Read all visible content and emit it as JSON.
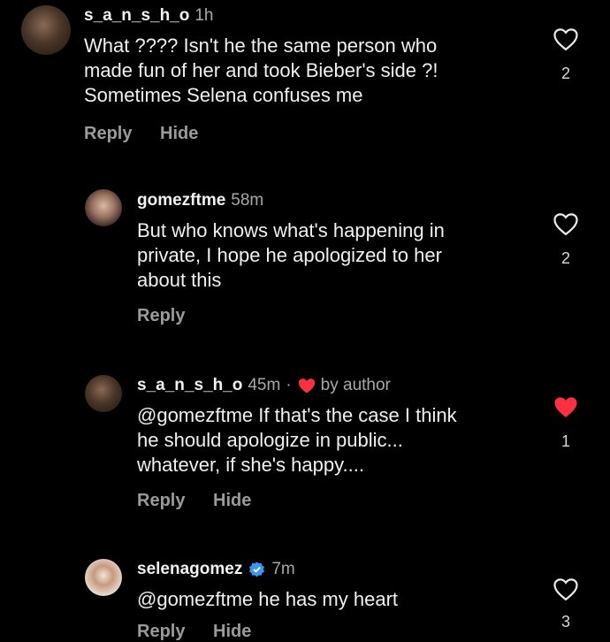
{
  "comments": [
    {
      "username": "s_a_n_s_h_o",
      "time": "1h",
      "text": "What ???? Isn't he the same person who\nmade fun of her and took Bieber's side ?!\nSometimes Selena confuses me",
      "reply_label": "Reply",
      "hide_label": "Hide",
      "likes": "2",
      "liked": false
    },
    {
      "username": "gomezftme",
      "time": "58m",
      "text": "But who knows what's happening in\nprivate, I hope he apologized to her\nabout this",
      "reply_label": "Reply",
      "likes": "2",
      "liked": false
    },
    {
      "username": "s_a_n_s_h_o",
      "time": "45m",
      "separator": "·",
      "author_badge": "by author",
      "text": "@gomezftme If that's the case I think\nhe should apologize in public...\nwhatever, if she's happy....",
      "reply_label": "Reply",
      "hide_label": "Hide",
      "likes": "1",
      "liked": true
    },
    {
      "username": "selenagomez",
      "time": "7m",
      "verified": true,
      "text": "@gomezftme he has my heart",
      "reply_label": "Reply",
      "hide_label": "Hide",
      "likes": "3",
      "liked": false
    }
  ],
  "colors": {
    "background": "#000000",
    "secondary_text": "#a8a8a8",
    "heart_red": "#ff3040",
    "verified_blue": "#3897f0"
  },
  "icons": {
    "like": "heart-outline-icon",
    "liked": "heart-filled-icon",
    "verified": "verified-badge-icon"
  }
}
